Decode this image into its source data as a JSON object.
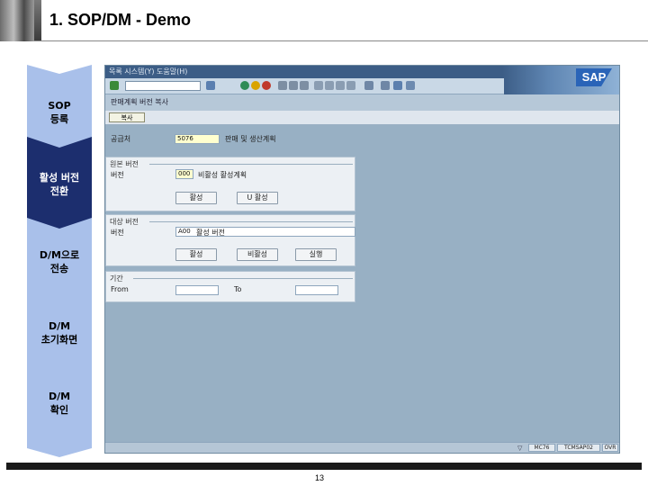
{
  "slide": {
    "title": "1. SOP/DM - Demo",
    "page_number": "13"
  },
  "steps": [
    {
      "label": "SOP\n등록"
    },
    {
      "label": "활성 버전\n전환",
      "active": true
    },
    {
      "label": "D/M으로\n전송"
    },
    {
      "label": "D/M\n초기화면"
    },
    {
      "label": "D/M\n확인"
    }
  ],
  "sap": {
    "menubar": "목록  시스템(Y)  도움말(H)",
    "title_bar": "판매계획 버전 복사",
    "app_button": "복사",
    "plant_label": "공급처",
    "plant_value": "5076",
    "plant_desc": "판매 및 생산계획",
    "group_from": {
      "title": "원본 버전",
      "version_label": "버전",
      "version_value": "000",
      "version_desc": "비활성  활성계획",
      "btn1": "활성",
      "btn2": "U 활성"
    },
    "group_to": {
      "title": "대상 버전",
      "version_label": "버전",
      "version_value": "A00",
      "version_desc": "활성 버전",
      "btn1": "활성",
      "btn2": "비활성",
      "btn3": "실행"
    },
    "group_period": {
      "title": "기간",
      "from_label": "From",
      "to_label": "To"
    },
    "status": {
      "cell1": "MC76",
      "cell2": "TCMSAP02",
      "cell3": "OVR"
    }
  },
  "colors": {
    "active_step": "#1c2e6e",
    "step_bg": "#a9c0ea",
    "sap_bg": "#98b0c4"
  }
}
